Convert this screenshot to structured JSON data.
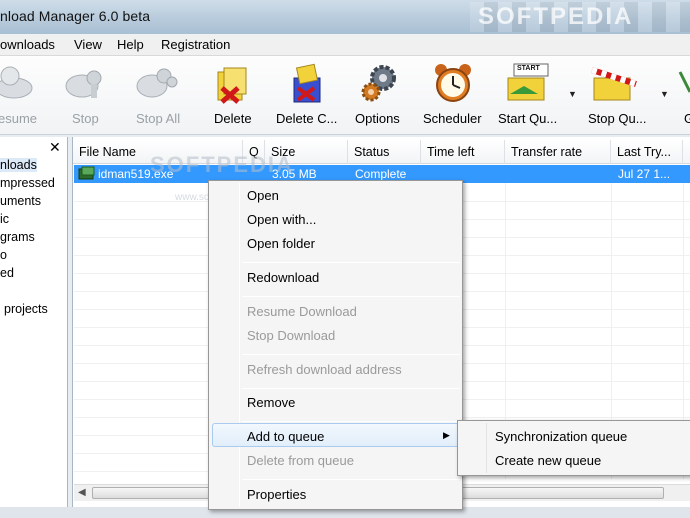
{
  "window": {
    "title": "nload Manager 6.0 beta",
    "watermark": "SOFTPEDIA"
  },
  "menu": [
    "ownloads",
    "View",
    "Help",
    "Registration"
  ],
  "toolbar": {
    "buttons": [
      {
        "label": "esume",
        "icon": "resume-icon",
        "enabled": false
      },
      {
        "label": "Stop",
        "icon": "stop-icon",
        "enabled": false
      },
      {
        "label": "Stop All",
        "icon": "stop-all-icon",
        "enabled": false
      },
      {
        "label": "Delete",
        "icon": "delete-icon",
        "enabled": true
      },
      {
        "label": "Delete C...",
        "icon": "delete-completed-icon",
        "enabled": true
      },
      {
        "label": "Options",
        "icon": "options-gear-icon",
        "enabled": true
      },
      {
        "label": "Scheduler",
        "icon": "scheduler-clock-icon",
        "enabled": true
      },
      {
        "label": "Start Qu...",
        "icon": "start-queue-icon",
        "enabled": true
      },
      {
        "label": "Stop Qu...",
        "icon": "stop-queue-icon",
        "enabled": true
      },
      {
        "label": "G",
        "icon": "grabber-icon",
        "enabled": true
      }
    ],
    "start_queue_badge": "START"
  },
  "categories": {
    "close_glyph": "✕",
    "items": [
      "nloads",
      "mpressed",
      "uments",
      "ic",
      "grams",
      "o",
      "ed",
      "",
      "projects"
    ]
  },
  "table": {
    "columns": [
      "File Name",
      "Q",
      "Size",
      "Status",
      "Time left",
      "Transfer rate",
      "Last Try...",
      "D"
    ],
    "rows": [
      {
        "file": "idman519.exe",
        "q": "",
        "size": "3.05 MB",
        "status": "Complete",
        "time_left": "",
        "rate": "",
        "last_try": "Jul 27 1..."
      }
    ]
  },
  "list_watermark": {
    "text": "SOFTPEDIA",
    "url": "www.softpedia.com"
  },
  "context_menu": {
    "items": [
      {
        "label": "Open",
        "enabled": true
      },
      {
        "label": "Open with...",
        "enabled": true
      },
      {
        "label": "Open folder",
        "enabled": true
      },
      {
        "label": "Redownload",
        "enabled": true
      },
      {
        "label": "Resume Download",
        "enabled": false
      },
      {
        "label": "Stop Download",
        "enabled": false
      },
      {
        "label": "Refresh download address",
        "enabled": false
      },
      {
        "label": "Remove",
        "enabled": true
      },
      {
        "label": "Add to queue",
        "enabled": true,
        "highlighted": true
      },
      {
        "label": "Delete from queue",
        "enabled": false
      },
      {
        "label": "Properties",
        "enabled": true
      }
    ]
  },
  "submenu": {
    "items": [
      "Synchronization queue",
      "Create new queue"
    ]
  },
  "colors": {
    "selection": "#3399ff",
    "menu_highlight_border": "#a8cbef"
  }
}
